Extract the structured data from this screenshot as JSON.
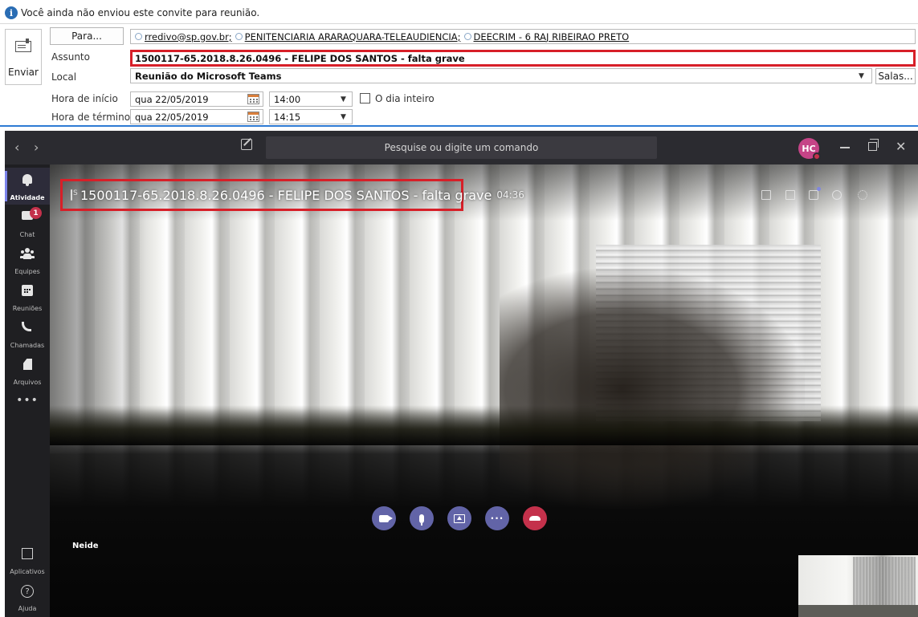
{
  "outlook": {
    "info_message": "Você ainda não enviou este convite para reunião.",
    "send_label": "Enviar",
    "to_button_label": "Para...",
    "recipients": [
      "rredivo@sp.gov.br;",
      "PENITENCIARIA ARARAQUARA-TELEAUDIENCIA;",
      "DEECRIM - 6 RAJ RIBEIRAO PRETO"
    ],
    "subject_label": "Assunto",
    "subject_value": "1500117-65.2018.8.26.0496 - FELIPE DOS SANTOS - falta grave",
    "location_label": "Local",
    "location_value": "Reunião do Microsoft Teams",
    "rooms_button_label": "Salas...",
    "start_label": "Hora de início",
    "start_date": "qua 22/05/2019",
    "start_time": "14:00",
    "all_day_label": "O dia inteiro",
    "end_label": "Hora de término",
    "end_date": "qua 22/05/2019",
    "end_time": "14:15"
  },
  "teams": {
    "search_placeholder": "Pesquise ou digite um comando",
    "avatar_initials": "HC",
    "rail": [
      {
        "label": "Atividade",
        "icon": "bell-icon",
        "active": true
      },
      {
        "label": "Chat",
        "icon": "chat-icon",
        "badge": "1"
      },
      {
        "label": "Equipes",
        "icon": "teams-icon"
      },
      {
        "label": "Reuniões",
        "icon": "calendar-icon"
      },
      {
        "label": "Chamadas",
        "icon": "phone-icon"
      },
      {
        "label": "Arquivos",
        "icon": "files-icon"
      }
    ],
    "more_label": "•••",
    "apps_label": "Aplicativos",
    "help_label": "Ajuda",
    "meeting_title": "1500117-65.2018.8.26.0496 - FELIPE DOS SANTOS - falta grave",
    "meeting_timer": "04:36",
    "participant_name": "Neide"
  },
  "colors": {
    "teams_accent": "#6264a7",
    "hangup_red": "#c4314b",
    "highlight_red": "#d71f28",
    "outlook_blue": "#2e7bd4"
  }
}
